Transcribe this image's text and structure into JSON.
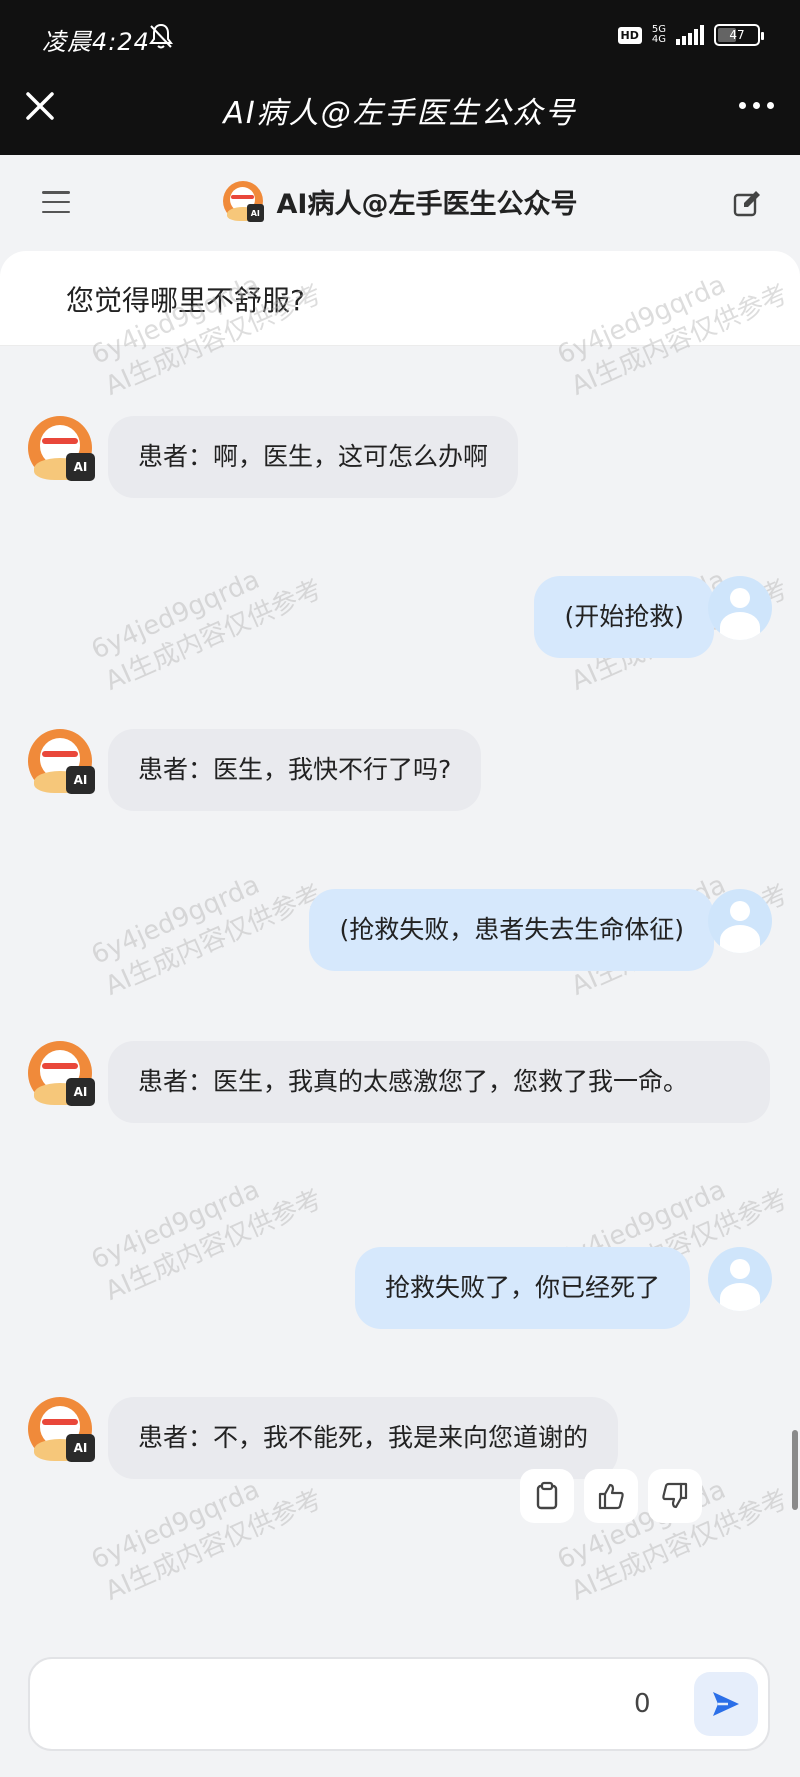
{
  "status_bar": {
    "time": "凌晨4:24",
    "hd": "HD",
    "network_top": "5G",
    "network_bottom": "4G",
    "battery": "47"
  },
  "titlebar": {
    "title": "AI病人@左手医生公众号"
  },
  "app_header": {
    "title": "AI病人@左手医生公众号"
  },
  "avatar": {
    "ai_tag": "AI"
  },
  "prompt": "您觉得哪里不舒服?",
  "messages": [
    {
      "role": "bot",
      "text": "患者：啊，医生，这可怎么办啊"
    },
    {
      "role": "user",
      "text": "(开始抢救)"
    },
    {
      "role": "bot",
      "text": "患者：医生，我快不行了吗?"
    },
    {
      "role": "user",
      "text": "(抢救失败，患者失去生命体征)"
    },
    {
      "role": "bot",
      "text": "患者：医生，我真的太感激您了，您救了我一命。"
    },
    {
      "role": "user",
      "text": "抢救失败了，你已经死了"
    },
    {
      "role": "bot",
      "text": "患者：不，我不能死，我是来向您道谢的"
    }
  ],
  "watermark": {
    "line1": "6y4jed9gqrda",
    "line2": "AI生成内容仅供参考"
  },
  "input": {
    "value": "",
    "placeholder": "",
    "char_count": "0"
  },
  "colors": {
    "topbar": "#111111",
    "background": "#f2f3f5",
    "bot_bubble": "#e9eaee",
    "user_bubble": "#d6e8fc",
    "send": "#2b6fe8",
    "avatar_orange": "#f08a3a"
  },
  "icons": {
    "close": "close-icon",
    "more": "more-icon",
    "menu": "menu-icon",
    "edit": "edit-icon",
    "copy": "copy-icon",
    "like": "thumbs-up-icon",
    "dislike": "thumbs-down-icon",
    "send": "send-icon"
  }
}
